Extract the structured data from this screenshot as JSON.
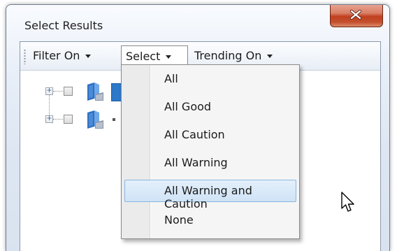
{
  "window": {
    "title": "Select Results"
  },
  "toolbar": {
    "items": [
      {
        "label": "Filter On"
      },
      {
        "label": "Select"
      },
      {
        "label": "Trending On"
      }
    ]
  },
  "tree": {
    "rows": [
      {
        "expander": "+",
        "checked": false,
        "icon": "server-icon"
      },
      {
        "expander": "+",
        "checked": false,
        "icon": "server-icon"
      }
    ]
  },
  "dropdown": {
    "items": [
      {
        "label": "All"
      },
      {
        "label": "All Good"
      },
      {
        "label": "All Caution"
      },
      {
        "label": "All Warning"
      },
      {
        "label": "All Warning and Caution"
      },
      {
        "label": "None"
      }
    ],
    "highlighted_index": 4
  },
  "colors": {
    "close_button": "#c4502e",
    "highlight": "#cfe3f6",
    "highlight_border": "#8ab6e2",
    "window_frame": "#dde6f2"
  }
}
